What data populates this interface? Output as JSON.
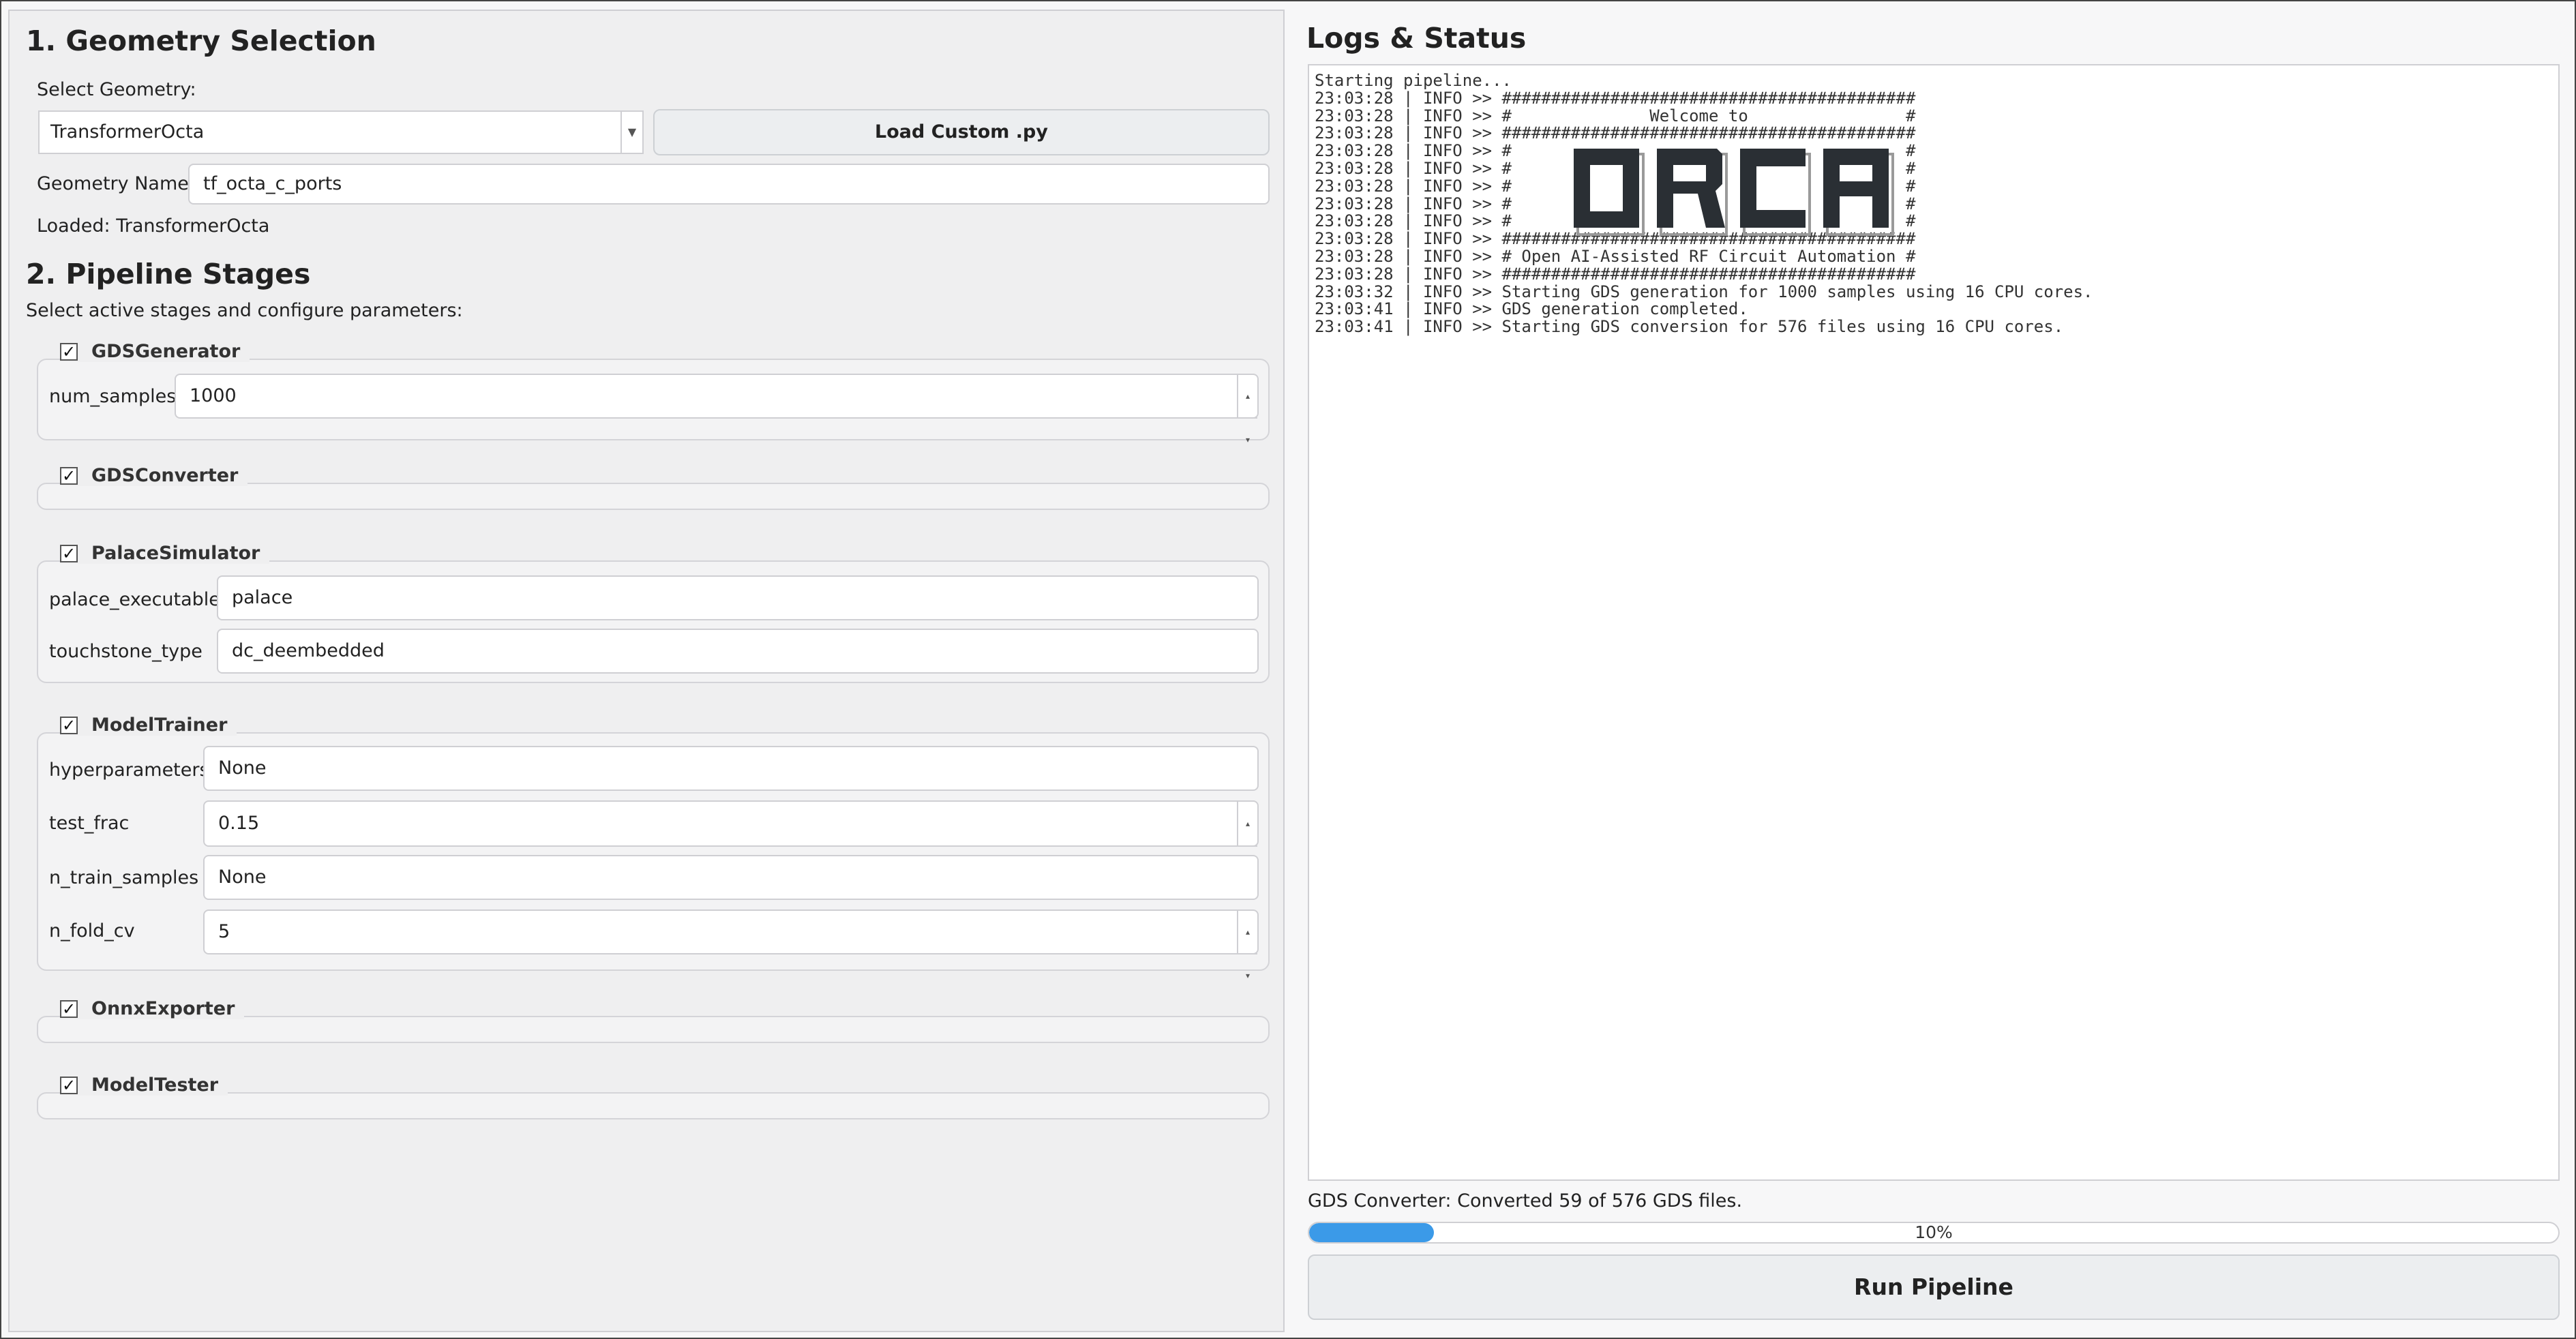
{
  "geometry": {
    "section_title": "1. Geometry Selection",
    "select_label": "Select Geometry:",
    "selected_geometry": "TransformerOcta",
    "load_custom_label": "Load Custom .py",
    "name_label": "Geometry Name:",
    "name_value": "tf_octa_c_ports",
    "loaded_text": "Loaded: TransformerOcta"
  },
  "pipeline": {
    "section_title": "2. Pipeline Stages",
    "subtitle": "Select active stages and configure parameters:",
    "stages": [
      {
        "name": "GDSGenerator",
        "checked": true,
        "params": [
          {
            "label": "num_samples",
            "value": "1000"
          }
        ]
      },
      {
        "name": "GDSConverter",
        "checked": true,
        "params": []
      },
      {
        "name": "PalaceSimulator",
        "checked": true,
        "params": [
          {
            "label": "palace_executable",
            "value": "palace"
          },
          {
            "label": "touchstone_type",
            "value": "dc_deembedded"
          }
        ]
      },
      {
        "name": "ModelTrainer",
        "checked": true,
        "params": [
          {
            "label": "hyperparameters",
            "value": "None"
          },
          {
            "label": "test_frac",
            "value": "0.15"
          },
          {
            "label": "n_train_samples",
            "value": "None"
          },
          {
            "label": "n_fold_cv",
            "value": "5"
          }
        ]
      },
      {
        "name": "OnnxExporter",
        "checked": true,
        "params": []
      },
      {
        "name": "ModelTester",
        "checked": true,
        "params": []
      }
    ]
  },
  "logs": {
    "title": "Logs & Status",
    "lines": [
      "Starting pipeline...",
      "23:03:28 | INFO >> ##########################################",
      "23:03:28 | INFO >> #              Welcome to                #",
      "23:03:28 | INFO >> ##########################################",
      "23:03:28 | INFO >> #                                        #",
      "23:03:28 | INFO >> #                                        #",
      "23:03:28 | INFO >> #                                        #",
      "23:03:28 | INFO >> #                                        #",
      "23:03:28 | INFO >> #                                        #",
      "23:03:28 | INFO >> ##########################################",
      "23:03:28 | INFO >> # Open AI-Assisted RF Circuit Automation #",
      "23:03:28 | INFO >> ##########################################",
      "23:03:32 | INFO >> Starting GDS generation for 1000 samples using 16 CPU cores.",
      "23:03:41 | INFO >> GDS generation completed.",
      "23:03:41 | INFO >> Starting GDS conversion for 576 files using 16 CPU cores."
    ],
    "banner_text": "ORCA"
  },
  "status": {
    "message": "GDS Converter: Converted 59 of 576 GDS files.",
    "progress": 0.1,
    "progress_text": "10%",
    "progress_color": "#3b9ae8"
  },
  "run_button_label": "Run Pipeline"
}
